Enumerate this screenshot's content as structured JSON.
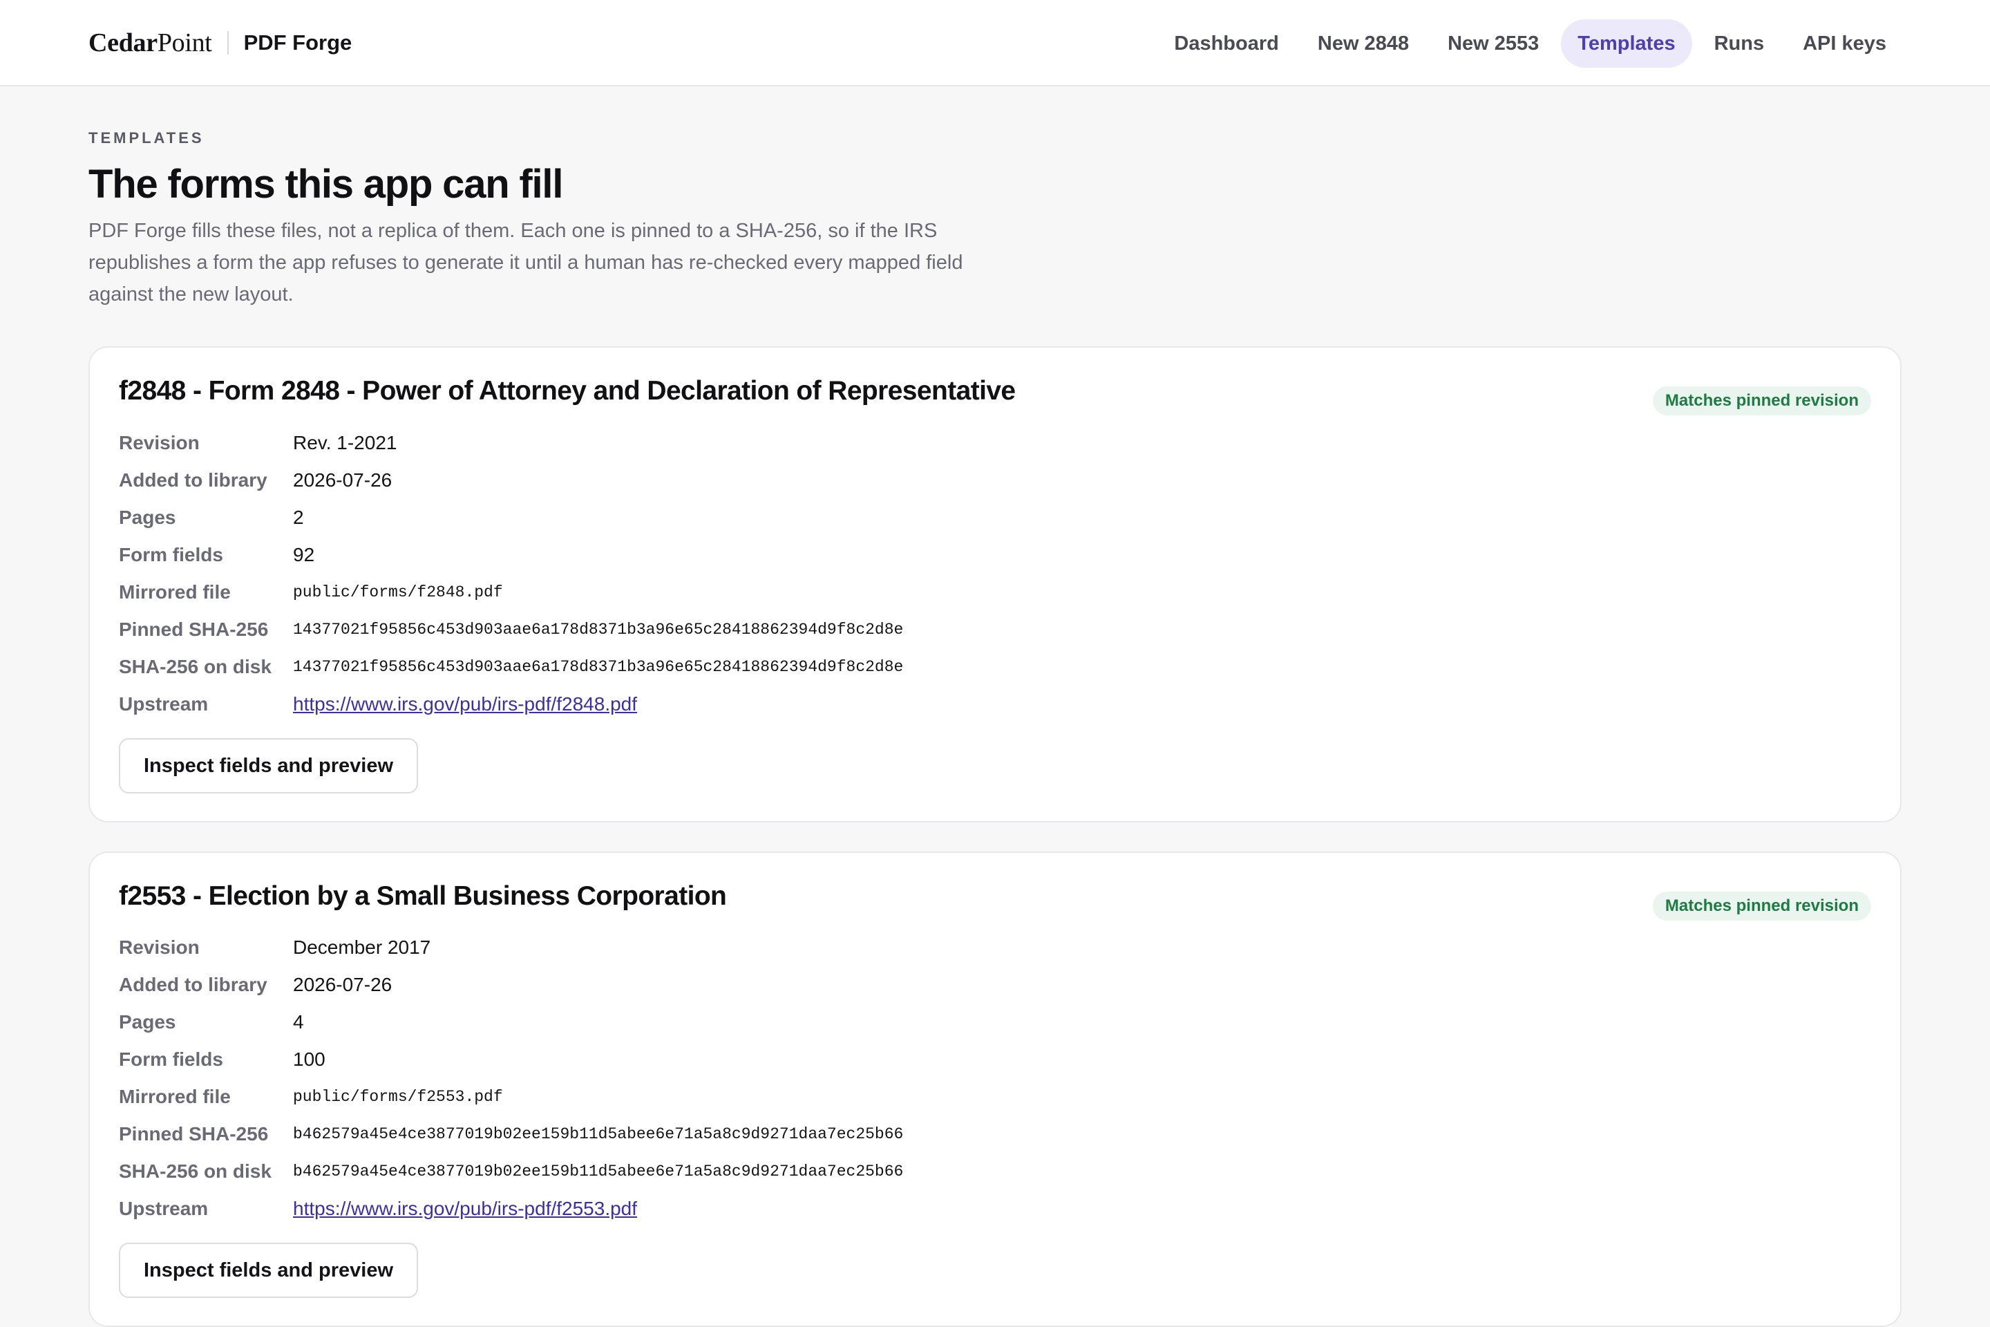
{
  "header": {
    "brand_prefix": "Cedar",
    "brand_suffix": "Point",
    "app_name": "PDF Forge",
    "nav": [
      {
        "label": "Dashboard",
        "active": false
      },
      {
        "label": "New 2848",
        "active": false
      },
      {
        "label": "New 2553",
        "active": false
      },
      {
        "label": "Templates",
        "active": true
      },
      {
        "label": "Runs",
        "active": false
      },
      {
        "label": "API keys",
        "active": false
      }
    ]
  },
  "page": {
    "eyebrow": "TEMPLATES",
    "title": "The forms this app can fill",
    "intro": "PDF Forge fills these files, not a replica of them. Each one is pinned to a SHA-256, so if the IRS republishes a form the app refuses to generate it until a human has re-checked every mapped field against the new layout."
  },
  "labels": {
    "revision": "Revision",
    "added": "Added to library",
    "pages": "Pages",
    "fields": "Form fields",
    "mirrored": "Mirrored file",
    "pinned": "Pinned SHA-256",
    "on_disk": "SHA-256 on disk",
    "upstream": "Upstream",
    "inspect_button": "Inspect fields and preview"
  },
  "templates": [
    {
      "title": "f2848 - Form 2848 - Power of Attorney and Declaration of Representative",
      "status": "Matches pinned revision",
      "revision": "Rev. 1-2021",
      "added": "2026-07-26",
      "pages": "2",
      "fields": "92",
      "mirrored": "public/forms/f2848.pdf",
      "pinned": "14377021f95856c453d903aae6a178d8371b3a96e65c28418862394d9f8c2d8e",
      "on_disk": "14377021f95856c453d903aae6a178d8371b3a96e65c28418862394d9f8c2d8e",
      "upstream": "https://www.irs.gov/pub/irs-pdf/f2848.pdf"
    },
    {
      "title": "f2553 - Election by a Small Business Corporation",
      "status": "Matches pinned revision",
      "revision": "December 2017",
      "added": "2026-07-26",
      "pages": "4",
      "fields": "100",
      "mirrored": "public/forms/f2553.pdf",
      "pinned": "b462579a45e4ce3877019b02ee159b11d5abee6e71a5a8c9d9271daa7ec25b66",
      "on_disk": "b462579a45e4ce3877019b02ee159b11d5abee6e71a5a8c9d9271daa7ec25b66",
      "upstream": "https://www.irs.gov/pub/irs-pdf/f2553.pdf"
    }
  ]
}
